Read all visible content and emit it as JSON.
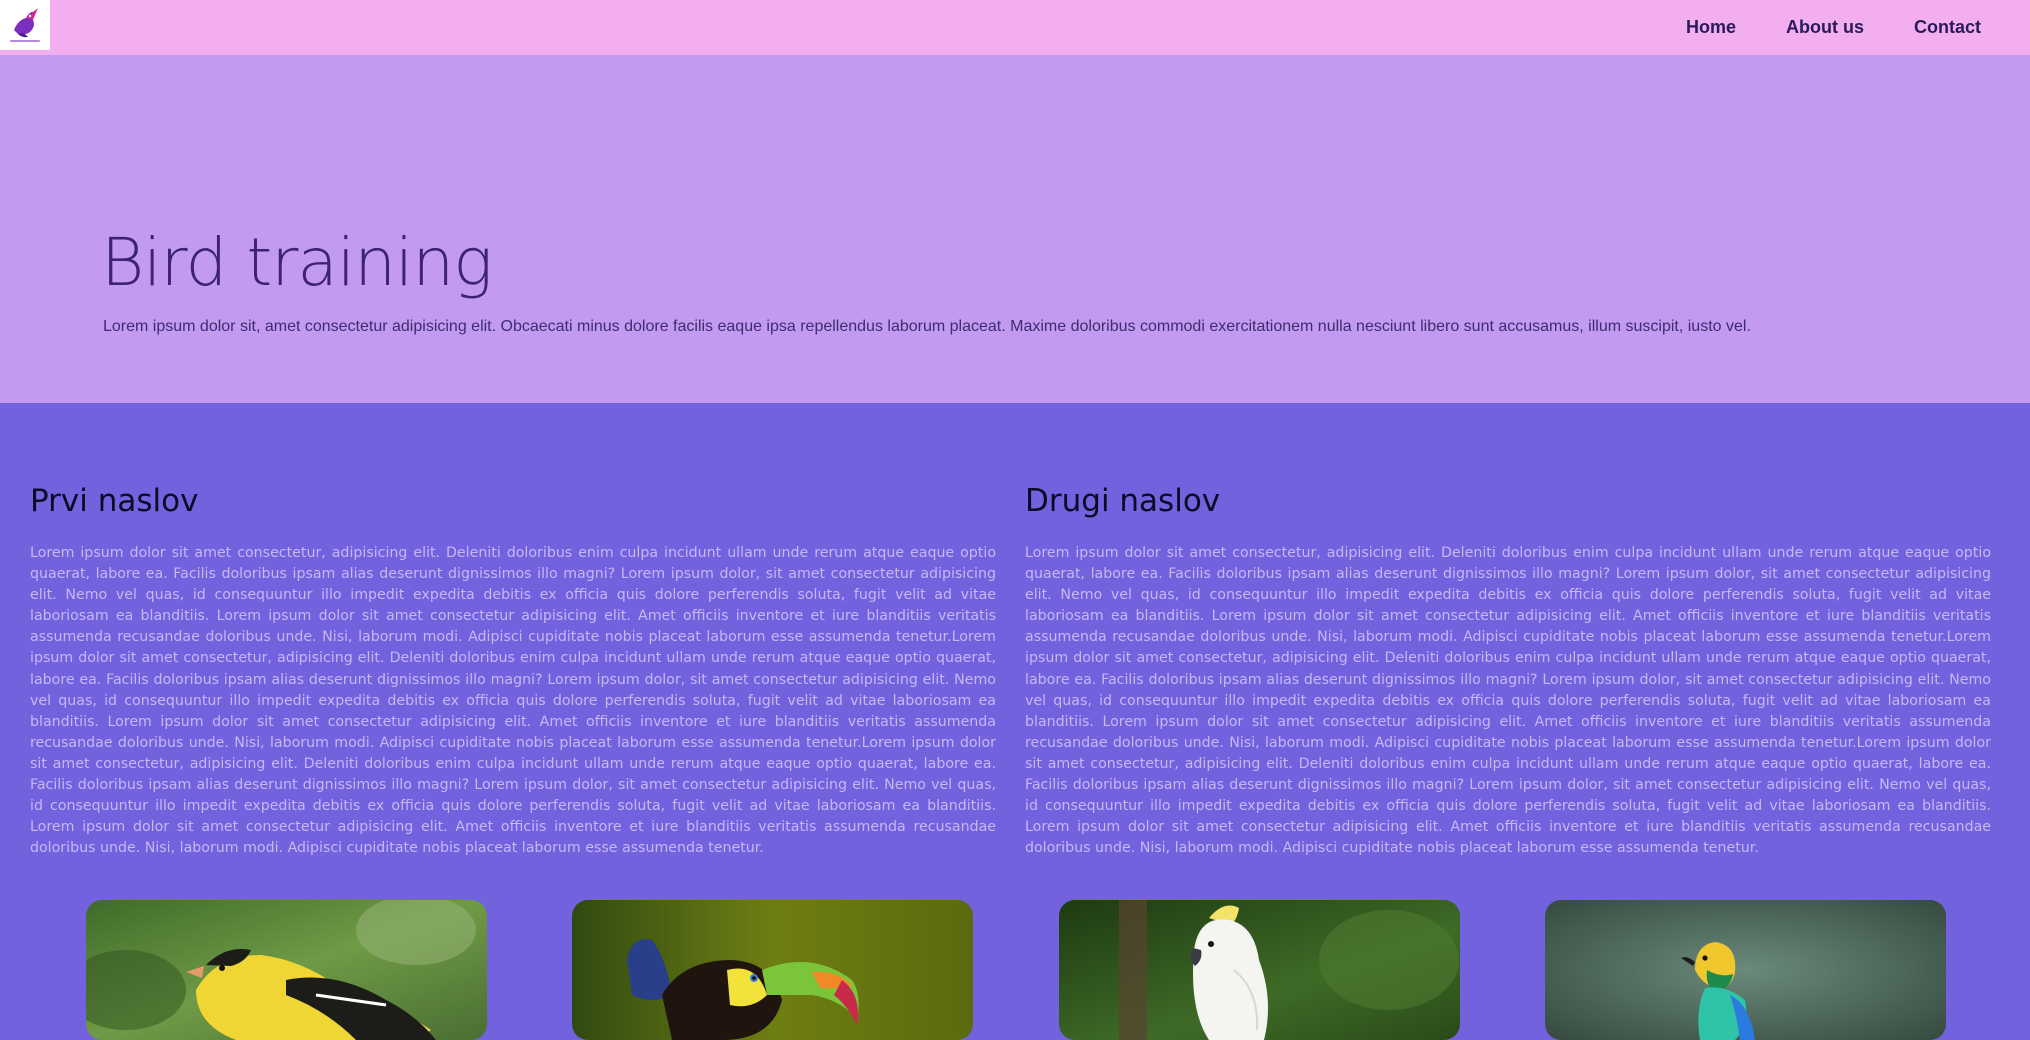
{
  "nav": {
    "logo_icon": "bird-logo-icon",
    "links": [
      {
        "label": "Home"
      },
      {
        "label": "About us"
      },
      {
        "label": "Contact"
      }
    ]
  },
  "hero": {
    "title": "Bird training",
    "text": "Lorem ipsum dolor sit, amet consectetur adipisicing elit. Obcaecati minus dolore facilis eaque ipsa repellendus laborum placeat. Maxime doloribus commodi exercitationem nulla nesciunt libero sunt accusamus, illum suscipit, iusto vel."
  },
  "columns": [
    {
      "heading": "Prvi naslov",
      "text": "Lorem ipsum dolor sit amet consectetur, adipisicing elit. Deleniti doloribus enim culpa incidunt ullam unde rerum atque eaque optio quaerat, labore ea. Facilis doloribus ipsam alias deserunt dignissimos illo magni? Lorem ipsum dolor, sit amet consectetur adipisicing elit. Nemo vel quas, id consequuntur illo impedit expedita debitis ex officia quis dolore perferendis soluta, fugit velit ad vitae laboriosam ea blanditiis. Lorem ipsum dolor sit amet consectetur adipisicing elit. Amet officiis inventore et iure blanditiis veritatis assumenda recusandae doloribus unde. Nisi, laborum modi. Adipisci cupiditate nobis placeat laborum esse assumenda tenetur.Lorem ipsum dolor sit amet consectetur, adipisicing elit. Deleniti doloribus enim culpa incidunt ullam unde rerum atque eaque optio quaerat, labore ea. Facilis doloribus ipsam alias deserunt dignissimos illo magni? Lorem ipsum dolor, sit amet consectetur adipisicing elit. Nemo vel quas, id consequuntur illo impedit expedita debitis ex officia quis dolore perferendis soluta, fugit velit ad vitae laboriosam ea blanditiis. Lorem ipsum dolor sit amet consectetur adipisicing elit. Amet officiis inventore et iure blanditiis veritatis assumenda recusandae doloribus unde. Nisi, laborum modi. Adipisci cupiditate nobis placeat laborum esse assumenda tenetur.Lorem ipsum dolor sit amet consectetur, adipisicing elit. Deleniti doloribus enim culpa incidunt ullam unde rerum atque eaque optio quaerat, labore ea. Facilis doloribus ipsam alias deserunt dignissimos illo magni? Lorem ipsum dolor, sit amet consectetur adipisicing elit. Nemo vel quas, id consequuntur illo impedit expedita debitis ex officia quis dolore perferendis soluta, fugit velit ad vitae laboriosam ea blanditiis. Lorem ipsum dolor sit amet consectetur adipisicing elit. Amet officiis inventore et iure blanditiis veritatis assumenda recusandae doloribus unde. Nisi, laborum modi. Adipisci cupiditate nobis placeat laborum esse assumenda tenetur."
    },
    {
      "heading": "Drugi naslov",
      "text": "Lorem ipsum dolor sit amet consectetur, adipisicing elit. Deleniti doloribus enim culpa incidunt ullam unde rerum atque eaque optio quaerat, labore ea. Facilis doloribus ipsam alias deserunt dignissimos illo magni? Lorem ipsum dolor, sit amet consectetur adipisicing elit. Nemo vel quas, id consequuntur illo impedit expedita debitis ex officia quis dolore perferendis soluta, fugit velit ad vitae laboriosam ea blanditiis. Lorem ipsum dolor sit amet consectetur adipisicing elit. Amet officiis inventore et iure blanditiis veritatis assumenda recusandae doloribus unde. Nisi, laborum modi. Adipisci cupiditate nobis placeat laborum esse assumenda tenetur.Lorem ipsum dolor sit amet consectetur, adipisicing elit. Deleniti doloribus enim culpa incidunt ullam unde rerum atque eaque optio quaerat, labore ea. Facilis doloribus ipsam alias deserunt dignissimos illo magni? Lorem ipsum dolor, sit amet consectetur adipisicing elit. Nemo vel quas, id consequuntur illo impedit expedita debitis ex officia quis dolore perferendis soluta, fugit velit ad vitae laboriosam ea blanditiis. Lorem ipsum dolor sit amet consectetur adipisicing elit. Amet officiis inventore et iure blanditiis veritatis assumenda recusandae doloribus unde. Nisi, laborum modi. Adipisci cupiditate nobis placeat laborum esse assumenda tenetur.Lorem ipsum dolor sit amet consectetur, adipisicing elit. Deleniti doloribus enim culpa incidunt ullam unde rerum atque eaque optio quaerat, labore ea. Facilis doloribus ipsam alias deserunt dignissimos illo magni? Lorem ipsum dolor, sit amet consectetur adipisicing elit. Nemo vel quas, id consequuntur illo impedit expedita debitis ex officia quis dolore perferendis soluta, fugit velit ad vitae laboriosam ea blanditiis. Lorem ipsum dolor sit amet consectetur adipisicing elit. Amet officiis inventore et iure blanditiis veritatis assumenda recusandae doloribus unde. Nisi, laborum modi. Adipisci cupiditate nobis placeat laborum esse assumenda tenetur."
    }
  ],
  "gallery": [
    {
      "subject": "goldfinch"
    },
    {
      "subject": "toucan"
    },
    {
      "subject": "cockatoo"
    },
    {
      "subject": "tanager"
    }
  ],
  "colors": {
    "navbar": "#f2aeee",
    "hero": "#c29af2",
    "content": "#7262de",
    "nav_text": "#2b1a5a",
    "hero_title": "#3d2370",
    "column_text": "#c7b7f5"
  }
}
